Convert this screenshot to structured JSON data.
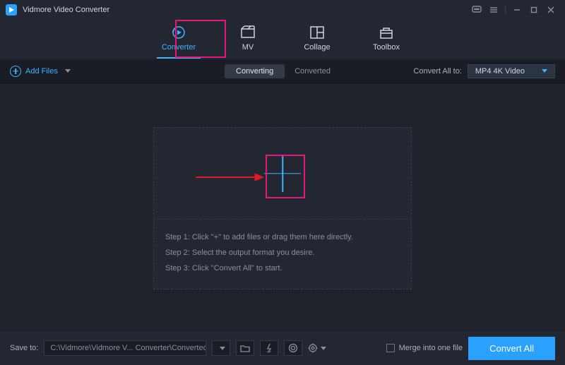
{
  "app": {
    "title": "Vidmore Video Converter"
  },
  "tabs": {
    "converter": "Converter",
    "mv": "MV",
    "collage": "Collage",
    "toolbox": "Toolbox"
  },
  "secondary": {
    "add_files": "Add Files",
    "converting": "Converting",
    "converted": "Converted",
    "convert_all_to": "Convert All to:",
    "format": "MP4 4K Video"
  },
  "drop": {
    "step1": "Step 1: Click \"+\" to add files or drag them here directly.",
    "step2": "Step 2: Select the output format you desire.",
    "step3": "Step 3: Click \"Convert All\" to start."
  },
  "footer": {
    "save_to": "Save to:",
    "path": "C:\\Vidmore\\Vidmore V... Converter\\Converted",
    "merge": "Merge into one file",
    "convert_all": "Convert All"
  }
}
